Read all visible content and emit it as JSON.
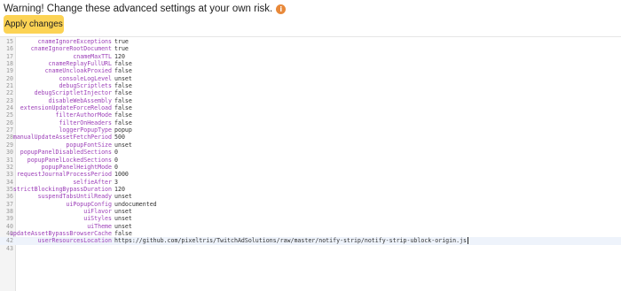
{
  "warning": {
    "text": "Warning! Change these advanced settings at your own risk.",
    "icon": "info-icon",
    "icon_color": "#e8893a"
  },
  "apply_button": {
    "label": "Apply changes",
    "color": "#fcd354"
  },
  "editor": {
    "colors": {
      "key": "#9c3fb8",
      "value": "#333333",
      "line_number": "#9a9a9a"
    },
    "rows": [
      {
        "n": "15",
        "key": "cnameIgnoreExceptions",
        "value": "true"
      },
      {
        "n": "16",
        "key": "cnameIgnoreRootDocument",
        "value": "true"
      },
      {
        "n": "17",
        "key": "cnameMaxTTL",
        "value": "120"
      },
      {
        "n": "18",
        "key": "cnameReplayFullURL",
        "value": "false"
      },
      {
        "n": "19",
        "key": "cnameUncloakProxied",
        "value": "false"
      },
      {
        "n": "20",
        "key": "consoleLogLevel",
        "value": "unset"
      },
      {
        "n": "21",
        "key": "debugScriptlets",
        "value": "false"
      },
      {
        "n": "22",
        "key": "debugScriptletInjector",
        "value": "false"
      },
      {
        "n": "23",
        "key": "disableWebAssembly",
        "value": "false"
      },
      {
        "n": "24",
        "key": "extensionUpdateForceReload",
        "value": "false"
      },
      {
        "n": "25",
        "key": "filterAuthorMode",
        "value": "false"
      },
      {
        "n": "26",
        "key": "filterOnHeaders",
        "value": "false"
      },
      {
        "n": "27",
        "key": "loggerPopupType",
        "value": "popup"
      },
      {
        "n": "28",
        "key": "manualUpdateAssetFetchPeriod",
        "value": "500"
      },
      {
        "n": "29",
        "key": "popupFontSize",
        "value": "unset"
      },
      {
        "n": "30",
        "key": "popupPanelDisabledSections",
        "value": "0"
      },
      {
        "n": "31",
        "key": "popupPanelLockedSections",
        "value": "0"
      },
      {
        "n": "32",
        "key": "popupPanelHeightMode",
        "value": "0"
      },
      {
        "n": "33",
        "key": "requestJournalProcessPeriod",
        "value": "1000"
      },
      {
        "n": "34",
        "key": "selfieAfter",
        "value": "3"
      },
      {
        "n": "35",
        "key": "strictBlockingBypassDuration",
        "value": "120"
      },
      {
        "n": "36",
        "key": "suspendTabsUntilReady",
        "value": "unset"
      },
      {
        "n": "37",
        "key": "uiPopupConfig",
        "value": "undocumented"
      },
      {
        "n": "38",
        "key": "uiFlavor",
        "value": "unset"
      },
      {
        "n": "39",
        "key": "uiStyles",
        "value": "unset"
      },
      {
        "n": "40",
        "key": "uiTheme",
        "value": "unset"
      },
      {
        "n": "41",
        "key": "updateAssetBypassBrowserCache",
        "value": "false"
      },
      {
        "n": "42",
        "key": "userResourcesLocation",
        "value": "https://github.com/pixeltris/TwitchAdSolutions/raw/master/notify-strip/notify-strip-ublock-origin.js",
        "active": true
      },
      {
        "n": "43",
        "key": "",
        "value": ""
      }
    ]
  }
}
